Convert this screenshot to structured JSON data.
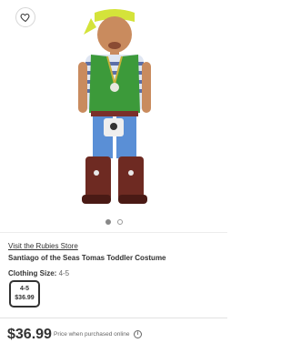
{
  "product": {
    "store_link": "Visit the Rubies Store",
    "title": "Santiago of the Seas Tomas Toddler Costume",
    "size_label": "Clothing Size:",
    "size_value": "4-5",
    "size_option": {
      "size": "4-5",
      "price": "$36.99"
    },
    "price": "$36.99",
    "price_note": "Price when purchased online",
    "info_glyph": "i"
  },
  "carousel": {
    "slide_count": 2,
    "active_index": 0
  },
  "icons": {
    "favorite": "heart-icon",
    "info": "info-icon"
  },
  "colors": {
    "vest": "#3c9a3a",
    "bandana": "#d4e33a",
    "boots": "#6e2a22",
    "pants": "#5a8fd6"
  }
}
